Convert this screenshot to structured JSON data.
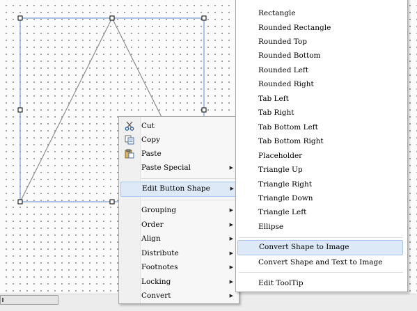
{
  "context_menu": {
    "items": [
      {
        "label": "Cut",
        "icon": "scissors-icon"
      },
      {
        "label": "Copy",
        "icon": "copy-icon"
      },
      {
        "label": "Paste",
        "icon": "paste-icon"
      },
      {
        "label": "Paste Special",
        "submenu": true
      },
      {
        "label": "Edit Button Shape",
        "submenu": true,
        "highlighted": true
      },
      {
        "label": "Grouping",
        "submenu": true
      },
      {
        "label": "Order",
        "submenu": true
      },
      {
        "label": "Align",
        "submenu": true
      },
      {
        "label": "Distribute",
        "submenu": true
      },
      {
        "label": "Footnotes",
        "submenu": true
      },
      {
        "label": "Locking",
        "submenu": true
      },
      {
        "label": "Convert",
        "submenu": true
      }
    ]
  },
  "submenu": {
    "items": [
      {
        "label": "Rectangle"
      },
      {
        "label": "Rounded Rectangle"
      },
      {
        "label": "Rounded Top"
      },
      {
        "label": "Rounded Bottom"
      },
      {
        "label": "Rounded Left"
      },
      {
        "label": "Rounded Right"
      },
      {
        "label": "Tab Left"
      },
      {
        "label": "Tab Right"
      },
      {
        "label": "Tab Bottom Left"
      },
      {
        "label": "Tab Bottom Right"
      },
      {
        "label": "Placeholder"
      },
      {
        "label": "Triangle Up"
      },
      {
        "label": "Triangle Right"
      },
      {
        "label": "Triangle Down"
      },
      {
        "label": "Triangle Left"
      },
      {
        "label": "Ellipse"
      },
      {
        "label": "Convert Shape to Image",
        "highlighted": true
      },
      {
        "label": "Convert Shape and Text to Image"
      },
      {
        "label": "Edit ToolTip"
      }
    ]
  },
  "colors": {
    "selection": "#4a7fc9",
    "highlight": "#dde9f7",
    "highlight_border": "#aac8ec"
  }
}
